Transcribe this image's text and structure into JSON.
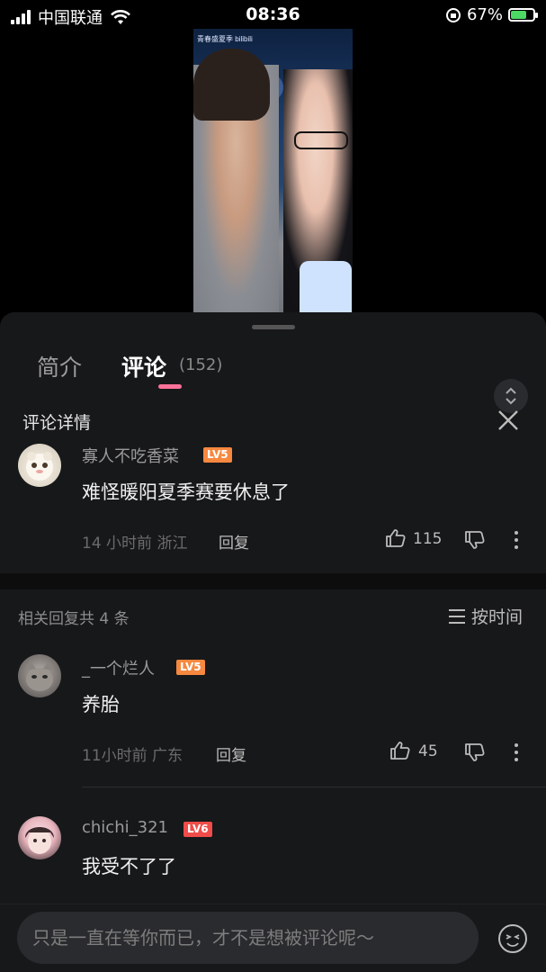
{
  "status_bar": {
    "carrier": "中国联通",
    "time": "08:36",
    "battery": "67%"
  },
  "video": {
    "watermark": "青春盛夏季 bilibili"
  },
  "tabs": {
    "intro": "简介",
    "comments": "评论",
    "comment_count": "(152)"
  },
  "detail": {
    "title": "评论详情"
  },
  "main_comment": {
    "username": "寡人不吃香菜",
    "level": "LV5",
    "text": "难怪暖阳夏季赛要休息了",
    "time_location": "14 小时前 浙江",
    "reply_label": "回复",
    "likes": "115"
  },
  "replies_header": {
    "count_text": "相关回复共 4 条",
    "sort_label": "按时间"
  },
  "replies": [
    {
      "username": "_一个烂人",
      "level": "LV5",
      "text": "养胎",
      "time_location": "11小时前 广东",
      "reply_label": "回复",
      "likes": "45"
    },
    {
      "username": "chichi_321",
      "level": "LV6",
      "text": "我受不了了"
    }
  ],
  "input": {
    "placeholder": "只是一直在等你而已，才不是想被评论呢～"
  },
  "colors": {
    "accent_pink": "#fb7299",
    "lv5": "#f6883f",
    "lv6": "#f04c49",
    "sheet_bg": "#17181a"
  }
}
